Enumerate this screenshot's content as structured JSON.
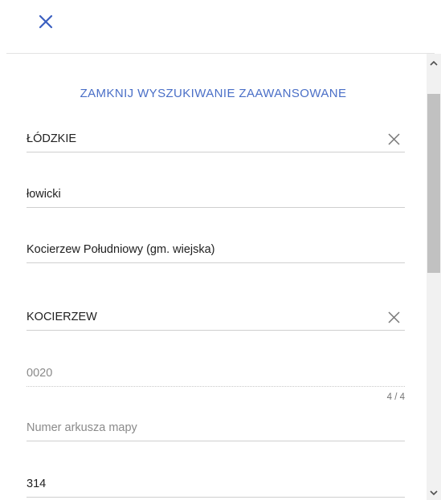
{
  "header": {
    "close_icon": "close-icon"
  },
  "advanced_search": {
    "toggle_label": "ZAMKNIJ WYSZUKIWANIE ZAAWANSOWANE"
  },
  "fields": {
    "voivodeship": {
      "value": "ŁÓDZKIE"
    },
    "county": {
      "value": "łowicki"
    },
    "commune": {
      "value": "Kocierzew Południowy (gm. wiejska)"
    },
    "precinct": {
      "value": "KOCIERZEW"
    },
    "parcel_number": {
      "value": "0020",
      "counter": "4 / 4"
    },
    "map_sheet": {
      "placeholder": "Numer arkusza mapy"
    },
    "parcel": {
      "value": "314"
    }
  },
  "colors": {
    "accent": "#4a6fc7",
    "close": "#3a5fc0"
  }
}
